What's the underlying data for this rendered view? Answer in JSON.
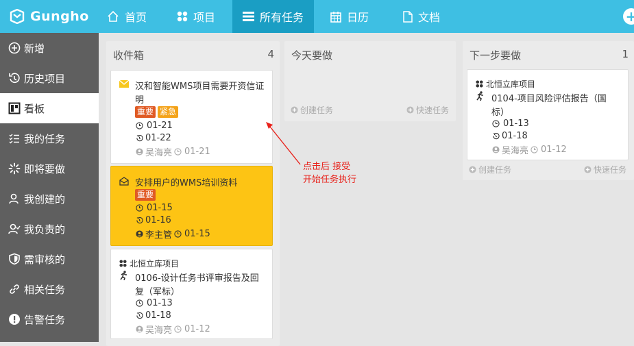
{
  "app": {
    "logo": "Gungho"
  },
  "topnav": [
    {
      "label": "首页",
      "icon": "home-icon"
    },
    {
      "label": "项目",
      "icon": "grid-icon"
    },
    {
      "label": "所有任务",
      "icon": "tasks-icon"
    },
    {
      "label": "日历",
      "icon": "calendar-icon"
    },
    {
      "label": "文档",
      "icon": "document-icon"
    }
  ],
  "sidebar": [
    {
      "label": "新增",
      "icon": "plus-circle-icon"
    },
    {
      "label": "历史项目",
      "icon": "history-icon"
    },
    {
      "label": "看板",
      "icon": "kanban-icon"
    },
    {
      "label": "我的任务",
      "icon": "list-icon"
    },
    {
      "label": "即将要做",
      "icon": "spinner-icon"
    },
    {
      "label": "我创建的",
      "icon": "user-icon"
    },
    {
      "label": "我负责的",
      "icon": "user-check-icon"
    },
    {
      "label": "需审核的",
      "icon": "shield-icon"
    },
    {
      "label": "相关任务",
      "icon": "link-icon"
    },
    {
      "label": "告警任务",
      "icon": "alert-icon"
    }
  ],
  "columns": {
    "inbox": {
      "title": "收件箱",
      "count": "4"
    },
    "today": {
      "title": "今天要做",
      "create": "创建任务",
      "quick": "快速任务"
    },
    "next": {
      "title": "下一步要做",
      "count": "1",
      "create": "创建任务",
      "quick": "快速任务"
    }
  },
  "cards": {
    "c1": {
      "title1": "汉和智能WMS项目需要开资信证",
      "title2": "明",
      "badge1": "重要",
      "badge2": "紧急",
      "start": "01-21",
      "due": "01-22",
      "owner": "吴海亮",
      "created": "01-21"
    },
    "c2": {
      "title": "安排用户的WMS培训资料",
      "badge1": "重要",
      "start": "01-15",
      "due": "01-16",
      "owner": "李主管",
      "created": "01-15"
    },
    "c3": {
      "project": "北恒立库项目",
      "title1": "0106-设计任务书评审报告及回",
      "title2": "复（军标）",
      "start": "01-13",
      "due": "01-18",
      "owner": "吴海亮",
      "created": "01-12"
    },
    "n1": {
      "project": "北恒立库项目",
      "title1": "0104-项目风险评估报告（国",
      "title2": "标）",
      "start": "01-13",
      "due": "01-18",
      "owner": "吴海亮",
      "created": "01-12"
    }
  },
  "annotation": {
    "line1": "点击后 接受",
    "line2": "开始任务执行"
  },
  "colors": {
    "topbar": "#3ebfe3",
    "topbar_active": "#1a9ec4",
    "sidebar": "#5f5f5f",
    "highlight_card": "#fdc414",
    "badge_important": "#e05a24",
    "badge_urgent": "#f4a31a",
    "annotation": "#e8211a"
  }
}
